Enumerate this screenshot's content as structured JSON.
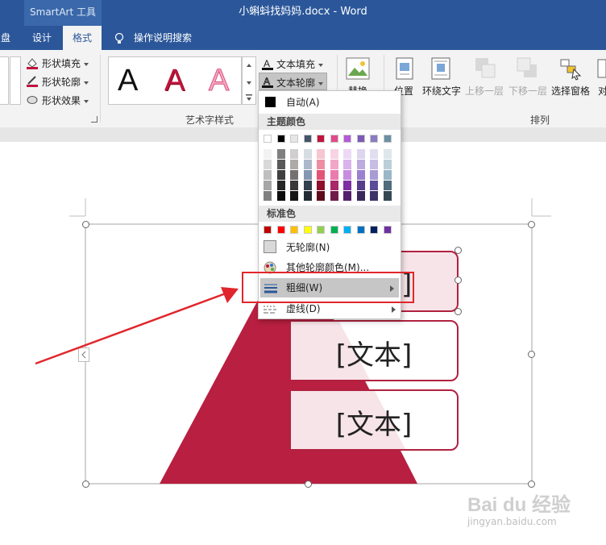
{
  "titlebar": {
    "context_tab": "SmartArt 工具",
    "doc_title": "小蝌蚪找妈妈.docx  -  Word"
  },
  "tabs": {
    "partial": "盘",
    "design": "设计",
    "format": "格式",
    "tell_me": "操作说明搜索"
  },
  "ribbon": {
    "shape_fill": "形状填充",
    "shape_outline": "形状轮廓",
    "shape_effects": "形状效果",
    "wordart_group": "艺术字样式",
    "text_fill": "文本填充",
    "text_outline": "文本轮廓",
    "wordart_glyph": "A",
    "replace_partial": "替换",
    "position": "位置",
    "wrap_text": "环绕文字",
    "bring_forward": "上移一层",
    "send_backward": "下移一层",
    "selection_pane": "选择窗格",
    "align_partial": "对",
    "arrange_group": "排列"
  },
  "menu": {
    "automatic": "自动(A)",
    "theme_colors_header": "主题颜色",
    "standard_colors_header": "标准色",
    "no_outline": "无轮廓(N)",
    "more_colors": "其他轮廓颜色(M)...",
    "weight": "粗细(W)",
    "dashes": "虚线(D)",
    "theme_top": [
      "#ffffff",
      "#000000",
      "#e7e6e6",
      "#44546a",
      "#c0143c",
      "#e04a8a",
      "#b35ad8",
      "#7b5bb5",
      "#8c7bc0",
      "#6b8fa3"
    ],
    "theme_shades": [
      [
        "#f2f2f2",
        "#d9d9d9",
        "#bfbfbf",
        "#a6a6a6",
        "#808080"
      ],
      [
        "#7f7f7f",
        "#595959",
        "#3f3f3f",
        "#262626",
        "#0d0d0d"
      ],
      [
        "#d0cece",
        "#aeaaaa",
        "#757171",
        "#3a3838",
        "#171616"
      ],
      [
        "#d6dce4",
        "#adb9ca",
        "#8497b0",
        "#333f4f",
        "#222a35"
      ],
      [
        "#f6c6d1",
        "#ed8ea3",
        "#e35575",
        "#900f2d",
        "#600a1e"
      ],
      [
        "#f8d3e4",
        "#f1a7c8",
        "#ea7bad",
        "#a8286a",
        "#701b47"
      ],
      [
        "#ecd9f5",
        "#d9b3ec",
        "#c78ce2",
        "#7e2fa3",
        "#54206d"
      ],
      [
        "#ded5ef",
        "#bdabe0",
        "#9c80d0",
        "#563c8a",
        "#39285c"
      ],
      [
        "#e2def1",
        "#c6bde3",
        "#a99cd5",
        "#5a4c99",
        "#3c3366"
      ],
      [
        "#dde7ec",
        "#bbcfd9",
        "#99b7c7",
        "#4e6c7c",
        "#344853"
      ]
    ],
    "standard": [
      "#c00000",
      "#ff0000",
      "#ffc000",
      "#ffff00",
      "#92d050",
      "#00b050",
      "#00b0f0",
      "#0070c0",
      "#002060",
      "#7030a0"
    ]
  },
  "smartart": {
    "box_text": "[文本]",
    "triangle_color": "#b81f40",
    "pale_color": "#f7e4e8"
  },
  "watermark": {
    "brand": "Bai du 经验",
    "url": "jingyan.baidu.com"
  },
  "colors": {
    "accent_blue": "#2b579a",
    "highlight_red": "#e1262b"
  }
}
